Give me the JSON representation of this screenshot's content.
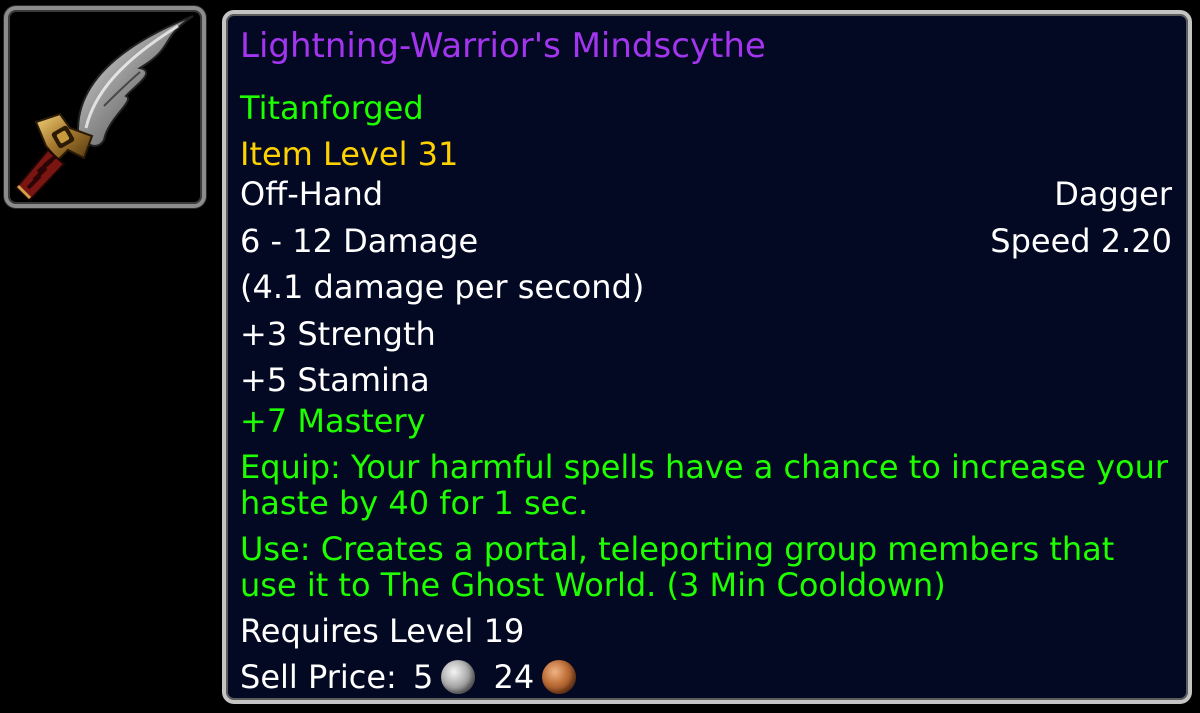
{
  "icon": {
    "name": "dagger-icon"
  },
  "item": {
    "name": "Lightning-Warrior's Mindscythe",
    "quality_color": "#a335ee",
    "tier": "Titanforged",
    "item_level": "Item Level 31",
    "slot": "Off-Hand",
    "type": "Dagger",
    "damage": "6 - 12 Damage",
    "speed": "Speed 2.20",
    "dps": "(4.1 damage per second)",
    "stats": [
      "+3 Strength",
      "+5 Stamina"
    ],
    "secondary_stat": "+7 Mastery",
    "equip_text": "Equip: Your harmful spells have a chance to increase your haste by 40 for 1 sec.",
    "use_text": "Use: Creates a portal, teleporting group members that use it to The Ghost World. (3 Min Cooldown)",
    "requires": "Requires Level 19",
    "sell_price_label": "Sell Price:",
    "sell_silver": "5",
    "sell_copper": "24"
  },
  "colors": {
    "tooltip_bg": "#030923",
    "border": "#c4c4c4",
    "green": "#1eff00",
    "yellow": "#ffd100",
    "epic": "#a335ee"
  }
}
